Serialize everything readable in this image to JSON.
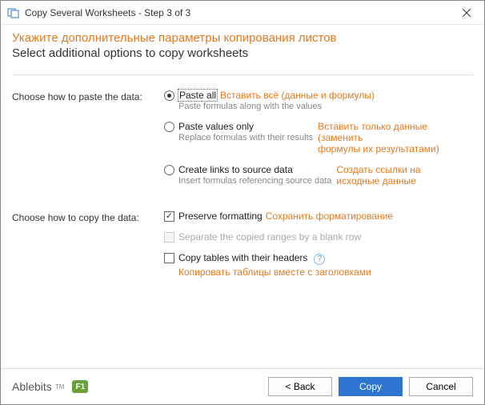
{
  "window": {
    "title": "Copy Several Worksheets - Step 3 of 3"
  },
  "header": {
    "heading_ru": "Укажите дополнительные параметры копирования листов",
    "heading_en": "Select additional options to copy worksheets"
  },
  "paste": {
    "section_label": "Choose how to paste the data:",
    "all": {
      "label": "Paste all",
      "annot": "Вставить всё (данные и формулы)",
      "desc": "Paste formulas along with the values"
    },
    "values": {
      "label": "Paste values only",
      "annot_line1": "Вставить только данные (заменить",
      "desc": "Replace formulas with their results",
      "annot_line2": "формулы их результатами)"
    },
    "links": {
      "label": "Create links to source data",
      "annot_line1": "Создать ссылки на",
      "desc": "Insert formulas referencing source data",
      "annot_line2": "исходные данные"
    }
  },
  "copy": {
    "section_label": "Choose how to copy the data:",
    "preserve": {
      "label": "Preserve formatting",
      "annot": "Сохранить форматирование"
    },
    "separate": {
      "label": "Separate the copied ranges by a blank row"
    },
    "headers": {
      "label": "Copy tables with their headers",
      "annot": "Копировать таблицы вместе с заголовками"
    }
  },
  "footer": {
    "brand": "Ablebits",
    "tm": "TM",
    "f1": "F1",
    "back": "<  Back",
    "copy": "Copy",
    "cancel": "Cancel"
  }
}
